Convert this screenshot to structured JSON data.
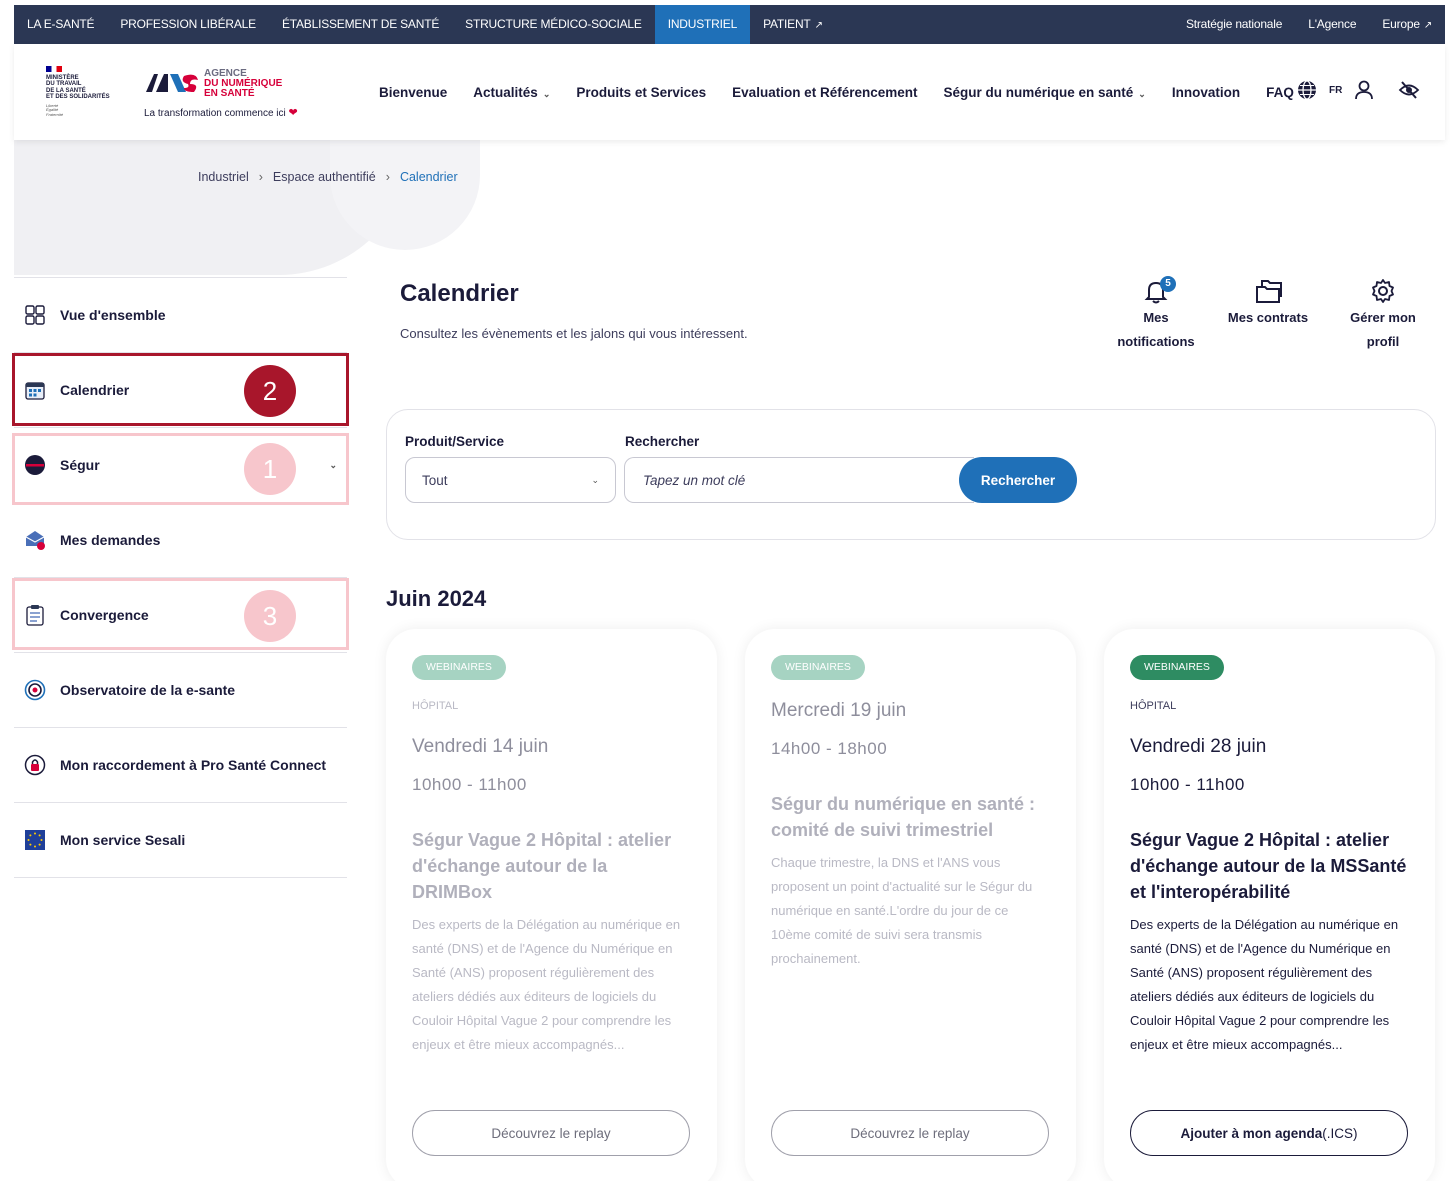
{
  "topbar": {
    "items": [
      "LA E-SANTÉ",
      "PROFESSION LIBÉRALE",
      "ÉTABLISSEMENT DE SANTÉ",
      "STRUCTURE MÉDICO-SOCIALE",
      "INDUSTRIEL",
      "PATIENT"
    ],
    "active": "INDUSTRIEL",
    "right": [
      "Stratégie nationale",
      "L'Agence",
      "Europe"
    ]
  },
  "header": {
    "ministere": [
      "MINISTÈRE",
      "DU TRAVAIL",
      "DE LA SANTÉ",
      "ET DES SOLIDARITÉS"
    ],
    "devise": [
      "Liberté",
      "Égalité",
      "Fraternité"
    ],
    "logo_lines": [
      "AGENCE",
      "DU NUMÉRIQUE",
      "EN SANTÉ"
    ],
    "tagline": "La transformation commence ici",
    "nav": [
      "Bienvenue",
      "Actualités",
      "Produits et Services",
      "Evaluation et Référencement",
      "Ségur du numérique en santé",
      "Innovation",
      "FAQ"
    ],
    "lang": "FR",
    "colors": {
      "brand_red": "#d6003a",
      "brand_navy": "#2b3754",
      "accent_blue": "#1f70b8"
    }
  },
  "breadcrumb": [
    "Industriel",
    "Espace authentifié",
    "Calendrier"
  ],
  "sidebar": {
    "items": [
      {
        "label": "Vue d'ensemble",
        "icon": "grid-icon"
      },
      {
        "label": "Calendrier",
        "icon": "calendar-icon"
      },
      {
        "label": "Ségur",
        "icon": "segur-logo-icon"
      },
      {
        "label": "Mes demandes",
        "icon": "requests-icon"
      },
      {
        "label": "Convergence",
        "icon": "clipboard-icon"
      },
      {
        "label": "Observatoire de la e-sante",
        "icon": "target-icon"
      },
      {
        "label": "Mon raccordement à Pro Santé Connect",
        "icon": "lock-badge-icon"
      },
      {
        "label": "Mon service Sesali",
        "icon": "eu-flag-icon"
      }
    ],
    "annotations": [
      "2",
      "1",
      "3"
    ]
  },
  "main": {
    "title": "Calendrier",
    "subtitle": "Consultez les évènements et les jalons qui vous intéressent.",
    "quick": {
      "notifications_label": "Mes notifications",
      "notifications_count": "5",
      "contracts_label": "Mes contrats",
      "profile_label": "Gérer mon profil"
    },
    "filter": {
      "product_label": "Produit/Service",
      "product_value": "Tout",
      "search_label": "Rechercher",
      "search_placeholder": "Tapez un mot clé",
      "search_button": "Rechercher"
    },
    "month": "Juin 2024",
    "events": [
      {
        "tag": "WEBINAIRES",
        "category": "HÔPITAL",
        "date": "Vendredi 14 juin",
        "time": "10h00 - 11h00",
        "title": "Ségur Vague 2 Hôpital : atelier d'échange autour de la DRIMBox",
        "description": "Des experts de la Délégation au numérique en santé (DNS) et de l'Agence du Numérique en Santé (ANS) proposent régulièrement des ateliers dédiés aux éditeurs de logiciels du Couloir Hôpital Vague 2 pour comprendre les enjeux et être mieux accompagnés...",
        "button": "Découvrez le replay"
      },
      {
        "tag": "WEBINAIRES",
        "category": "",
        "date": "Mercredi 19 juin",
        "time": "14h00 - 18h00",
        "title": "Ségur du numérique en santé : comité de suivi trimestriel",
        "description": "Chaque trimestre, la DNS et l'ANS vous proposent un point d'actualité sur le Ségur du numérique en santé.L'ordre du jour de ce 10ème comité de suivi sera transmis prochainement.",
        "button": "Découvrez le replay"
      },
      {
        "tag": "WEBINAIRES",
        "category": "HÔPITAL",
        "date": "Vendredi 28 juin",
        "time": "10h00 - 11h00",
        "title": "Ségur Vague 2 Hôpital : atelier d'échange autour de la MSSanté et l'interopérabilité",
        "description": "Des experts de la Délégation au numérique en santé (DNS) et de l'Agence du Numérique en Santé (ANS) proposent régulièrement des ateliers dédiés aux éditeurs de logiciels du Couloir Hôpital Vague 2 pour comprendre les enjeux et être mieux accompagnés...",
        "button_main": "Ajouter à mon agenda",
        "button_suffix": " (.ICS)"
      }
    ]
  }
}
